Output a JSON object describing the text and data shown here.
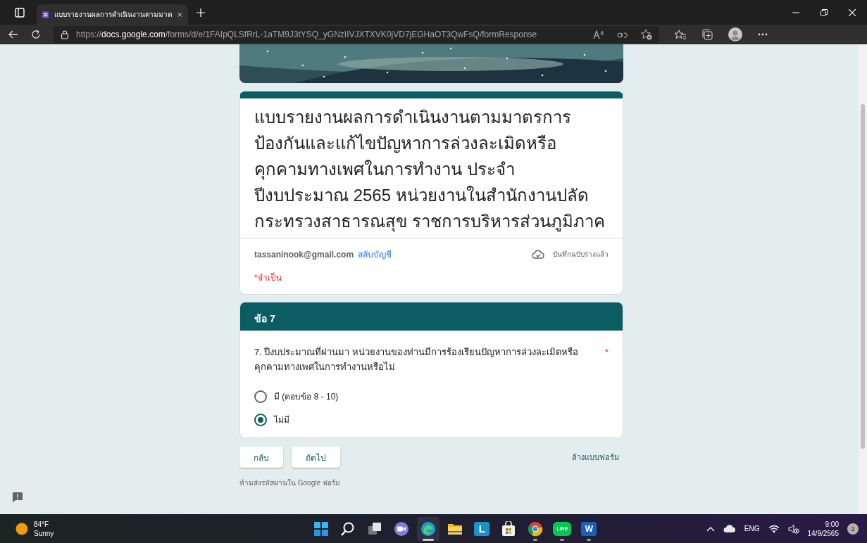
{
  "browser": {
    "tab_title": "แบบรายงานผลการดำเนินงานตามมาต",
    "url": {
      "scheme": "https://",
      "host": "docs.google.com",
      "path": "/forms/d/e/1FAIpQLSfRrL-1aTM9J3tYSQ_yGNzIIVJXTXVK0jVD7jEGHaOT3QwFsQ/formResponse"
    }
  },
  "form": {
    "title": "แบบรายงานผลการดำเนินงานตามมาตรการป้องกันและแก้ไขปัญหาการล่วงละเมิดหรือคุกคามทางเพศในการทำงาน ประจำปีงบประมาณ 2565 หน่วยงานในสำนักงานปลัดกระทรวงสาธารณสุข  ราชการบริหารส่วนภูมิภาค",
    "account": {
      "email": "tassaninook@gmail.com",
      "switch_link": "สลับบัญชี"
    },
    "draft_status": "บันทึกฉบับร่างแล้ว",
    "required_note": "*จำเป็น",
    "section": {
      "title": "ข้อ 7"
    },
    "question": {
      "text": "7. ปีงบประมาณที่ผ่านมา หน่วยงานของท่านมีการร้องเรียนปัญหาการล่วงละเมิดหรือคุกคามทางเพศในการทำงานหรือไม่",
      "required": true,
      "required_mark": "*",
      "options": [
        {
          "label": "มี (ตอบข้อ 8 - 10)",
          "selected": false
        },
        {
          "label": "ไม่มี",
          "selected": true
        }
      ]
    },
    "buttons": [
      {
        "label": "กลับ"
      },
      {
        "label": "ถัดไป"
      }
    ],
    "clear_link": "ล้างแบบฟอร์ม",
    "footer_note": "ห้ามส่งรหัสผ่านใน Google ฟอร์ม"
  },
  "taskbar": {
    "weather": {
      "temperature": "84°F",
      "condition": "Sunny"
    },
    "apps": [
      {
        "kind": "start",
        "running": false,
        "selected": false
      },
      {
        "kind": "search",
        "running": false,
        "selected": false
      },
      {
        "kind": "taskview",
        "running": false,
        "selected": false
      },
      {
        "kind": "chat",
        "running": false,
        "selected": false
      },
      {
        "kind": "edge",
        "running": true,
        "selected": true
      },
      {
        "kind": "folder",
        "running": false,
        "selected": false
      },
      {
        "kind": "letter",
        "glyph": "L",
        "running": false,
        "selected": false
      },
      {
        "kind": "store",
        "running": false,
        "selected": false
      },
      {
        "kind": "chrome",
        "running": true,
        "selected": false
      },
      {
        "kind": "line",
        "glyph": "LINE",
        "running": true,
        "selected": false
      },
      {
        "kind": "word",
        "glyph": "W",
        "running": true,
        "selected": false
      }
    ],
    "language": "ENG",
    "time": "9:00",
    "date": "14/9/2565",
    "notifications": "1"
  }
}
